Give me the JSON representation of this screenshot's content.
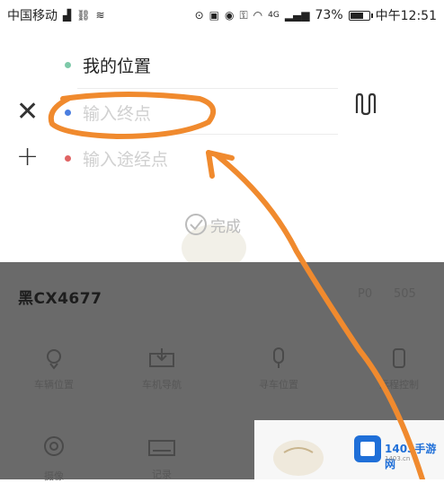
{
  "status_bar": {
    "carrier": "中国移动",
    "network": "4G",
    "battery": "73%",
    "battery_level": 0.73,
    "time": "中午12:51"
  },
  "route": {
    "origin": "我的位置",
    "destination_placeholder": "输入终点",
    "waypoint_placeholder": "输入途经点",
    "close_icon": "close-icon",
    "add_icon": "plus-icon",
    "swap_icon": "swap-icon",
    "colors": {
      "origin_dot": "#7ec9a9",
      "destination_dot": "#4a7ee0",
      "waypoint_dot": "#e06464"
    }
  },
  "done": {
    "label": "完成"
  },
  "vehicle": {
    "plate": "黑CX4677",
    "right_a": "P0",
    "right_b": "505"
  },
  "actions": [
    {
      "label": "车辆位置",
      "icon": "car-location-icon"
    },
    {
      "label": "车机导航",
      "icon": "car-nav-icon"
    },
    {
      "label": "寻车位置",
      "icon": "find-car-icon"
    },
    {
      "label": "远程控制",
      "icon": "remote-icon"
    },
    {
      "label": "摄像",
      "icon": "camera-icon"
    },
    {
      "label": "记录",
      "icon": "record-icon"
    },
    {
      "label": "",
      "icon": "car-icon"
    }
  ],
  "logo": {
    "name": "1403手游网",
    "sub": "1403.cn"
  },
  "annotation_color": "#f08a2e"
}
